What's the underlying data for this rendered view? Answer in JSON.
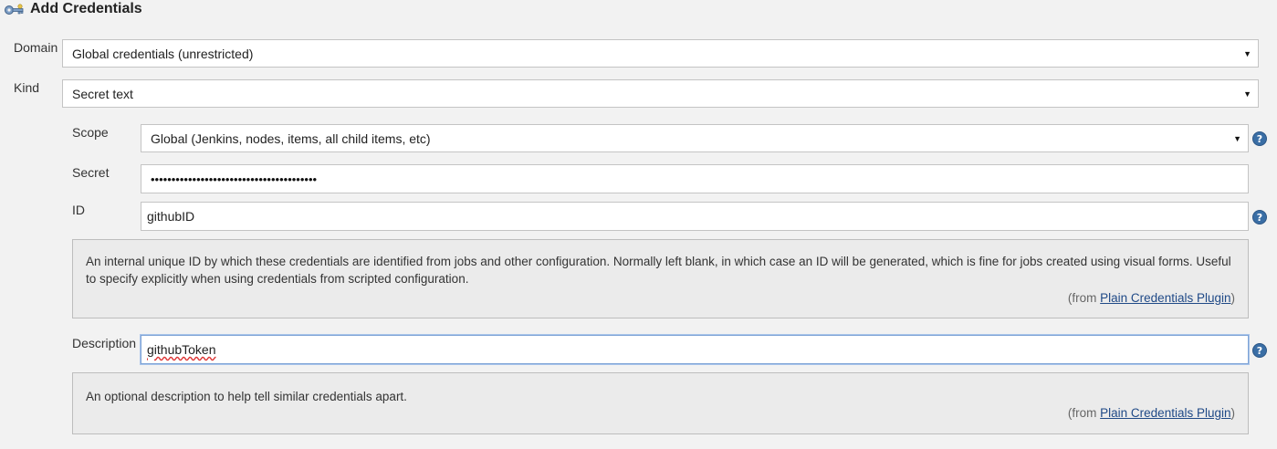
{
  "page": {
    "title": "Add Credentials",
    "icon": "credentials-key-icon"
  },
  "form": {
    "domain": {
      "label": "Domain",
      "value": "Global credentials (unrestricted)"
    },
    "kind": {
      "label": "Kind",
      "value": "Secret text"
    },
    "scope": {
      "label": "Scope",
      "value": "Global (Jenkins, nodes, items, all child items, etc)"
    },
    "secret": {
      "label": "Secret",
      "masked_value": "••••••••••••••••••••••••••••••••••••••••"
    },
    "id": {
      "label": "ID",
      "value": "githubID",
      "help_text": "An internal unique ID by which these credentials are identified from jobs and other configuration. Normally left blank, in which case an ID will be generated, which is fine for jobs created using visual forms. Useful to specify explicitly when using credentials from scripted configuration.",
      "help_from_prefix": "(from ",
      "help_from_link": "Plain Credentials Plugin",
      "help_from_suffix": ")"
    },
    "description": {
      "label": "Description",
      "value": "githubToken",
      "help_text": "An optional description to help tell similar credentials apart.",
      "help_from_prefix": "(from ",
      "help_from_link": "Plain Credentials Plugin",
      "help_from_suffix": ")"
    }
  },
  "icons": {
    "dropdown": "chevron-down-icon",
    "help": "help-icon",
    "help_glyph": "?",
    "caret_glyph": "▼"
  },
  "colors": {
    "background": "#f2f2f2",
    "help_box": "#ebebeb",
    "help_icon": "#3a6ea5",
    "link": "#204a87",
    "focus_border": "#7ea3d6"
  }
}
